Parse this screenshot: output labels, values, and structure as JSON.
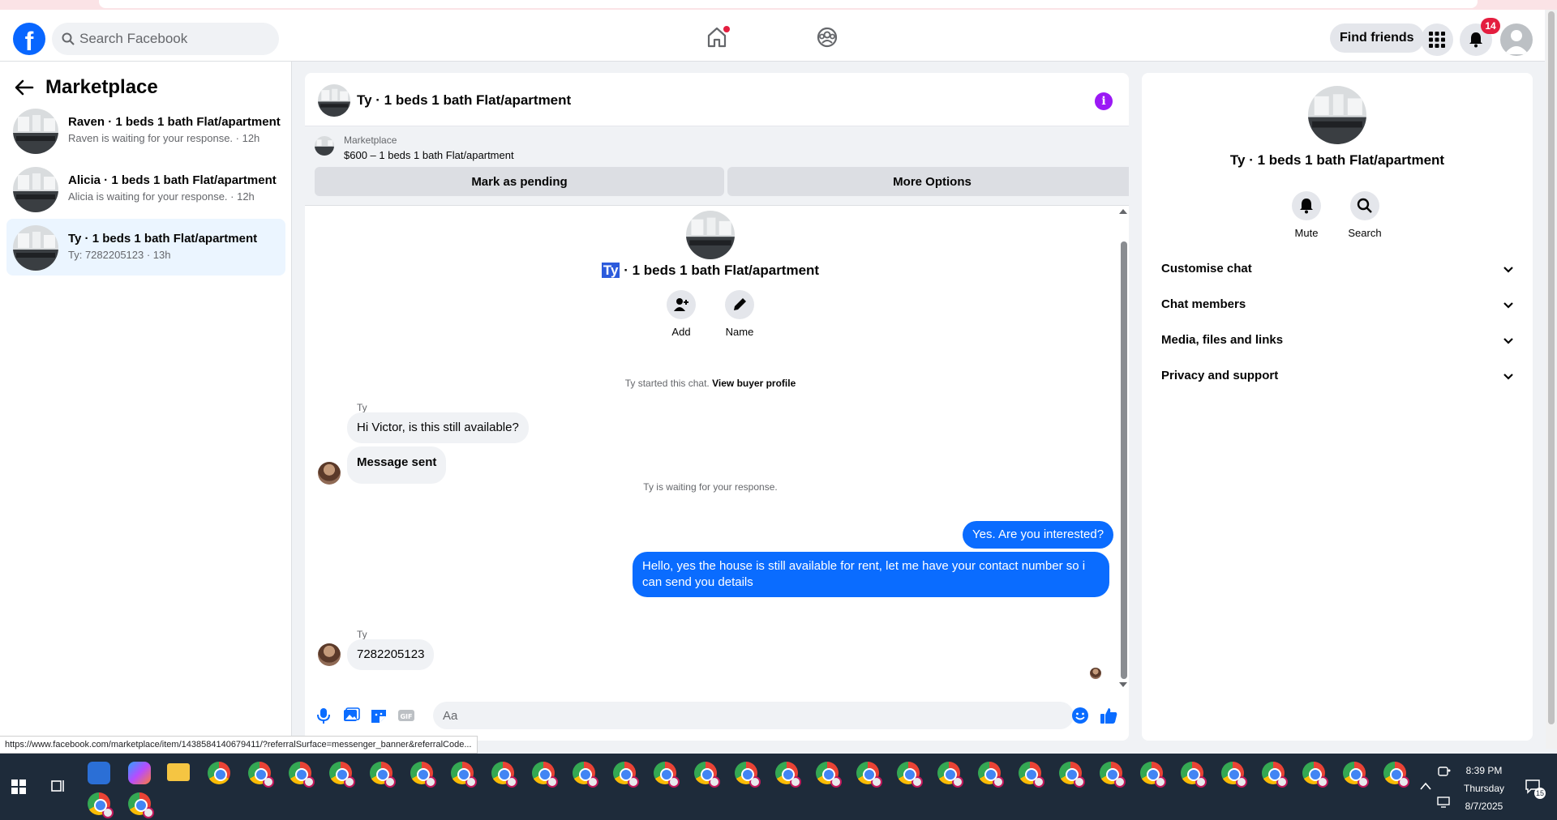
{
  "topbar": {
    "logo": "f",
    "search_placeholder": "Search Facebook",
    "find_friends": "Find friends",
    "notification_count": "14"
  },
  "sidebar": {
    "title": "Marketplace",
    "conversations": [
      {
        "title": "Raven · 1 beds 1 bath Flat/apartment",
        "subtitle": "Raven is waiting for your response. · 12h"
      },
      {
        "title": "Alicia · 1 beds 1 bath Flat/apartment",
        "subtitle": "Alicia is waiting for your response. · 12h"
      },
      {
        "title": "Ty · 1 beds 1 bath Flat/apartment",
        "subtitle": "Ty: 7282205123 · 13h"
      }
    ]
  },
  "chat": {
    "title": "Ty · 1 beds 1 bath Flat/apartment",
    "banner": {
      "source": "Marketplace",
      "listing": "$600 – 1 beds 1 bath Flat/apartment",
      "mark_pending": "Mark as pending",
      "more_options": "More Options"
    },
    "header_name_selected": "Ty",
    "header_name_rest": " · 1 beds 1 bath Flat/apartment",
    "actions": {
      "add": "Add",
      "name": "Name"
    },
    "started_text": "Ty started this chat.",
    "view_profile": "View buyer profile",
    "waiting_text": "Ty is waiting for your response.",
    "messages": {
      "sender1": "Ty",
      "in1": "Hi Victor, is this still available?",
      "in2": "Message sent",
      "out1": "Yes. Are you interested?",
      "out2": "Hello, yes the house is still available for rent, let me have your contact number so i can send you details",
      "sender2": "Ty",
      "in3": "7282205123"
    },
    "composer_placeholder": "Aa"
  },
  "right_panel": {
    "title": "Ty · 1 beds 1 bath Flat/apartment",
    "mute": "Mute",
    "search": "Search",
    "sections": [
      "Customise chat",
      "Chat members",
      "Media, files and links",
      "Privacy and support"
    ]
  },
  "status_url": "https://www.facebook.com/marketplace/item/1438584140679411/?referralSurface=messenger_banner&referralCode...",
  "taskbar": {
    "time": "8:39 PM",
    "day": "Thursday",
    "date": "8/7/2025",
    "notif_count": "15"
  },
  "colors": {
    "fb_blue": "#0866ff",
    "outgoing_bubble": "#0a6cff",
    "active_conversation": "#ebf5ff",
    "badge_red": "#e41e3f",
    "info_purple": "#9b19f5"
  }
}
